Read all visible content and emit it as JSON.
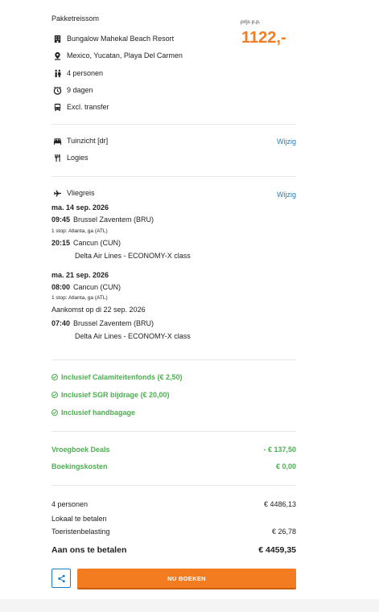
{
  "package": {
    "title": "Pakketreissom",
    "price_label": "prijs p.p.",
    "price": "1122,-",
    "hotel": "Bungalow Mahekal Beach Resort",
    "location": "Mexico, Yucatan, Playa Del Carmen",
    "persons": "4 personen",
    "duration": "9 dagen",
    "transfer": "Excl. transfer"
  },
  "room": {
    "view": "Tuinzicht [dr]",
    "board": "Logies",
    "change_link": "Wijzig"
  },
  "flight": {
    "title": "Vliegreis",
    "change_link": "Wijzig",
    "outbound": {
      "date": "ma. 14 sep. 2026",
      "dep_time": "09:45",
      "dep_airport": "Brussel Zaventem (BRU)",
      "stop": "1 stop: Atlanta, ga (ATL)",
      "arr_time": "20:15",
      "arr_airport": "Cancun (CUN)",
      "carrier": "Delta Air Lines - ECONOMY-X class"
    },
    "return": {
      "date": "ma. 21 sep. 2026",
      "dep_time": "08:00",
      "dep_airport": "Cancun (CUN)",
      "stop": "1 stop: Atlanta, ga (ATL)",
      "arrival_note": "Aankomst op di 22 sep. 2026",
      "arr_time": "07:40",
      "arr_airport": "Brussel Zaventem (BRU)",
      "carrier": "Delta Air Lines - ECONOMY-X class"
    }
  },
  "inclusions": [
    "Inclusief Calamiteitenfonds (€ 2,50)",
    "Inclusief SGR bijdrage (€ 20,00)",
    "Inclusief handbagage"
  ],
  "discounts": {
    "early_label": "Vroegboek Deals",
    "early_value": "- € 137,50",
    "booking_label": "Boekingskosten",
    "booking_value": "€ 0,00"
  },
  "totals": {
    "persons_label": "4 personen",
    "persons_value": "€ 4486,13",
    "local_label": "Lokaal te betalen",
    "tax_label": "Toeristenbelasting",
    "tax_value": "€ 26,78",
    "pay_label": "Aan ons te betalen",
    "pay_value": "€ 4459,35"
  },
  "actions": {
    "book_label": "NU BOEKEN"
  },
  "colors": {
    "accent": "#f47c20",
    "link": "#1c7fc2",
    "success": "#4caf50"
  }
}
